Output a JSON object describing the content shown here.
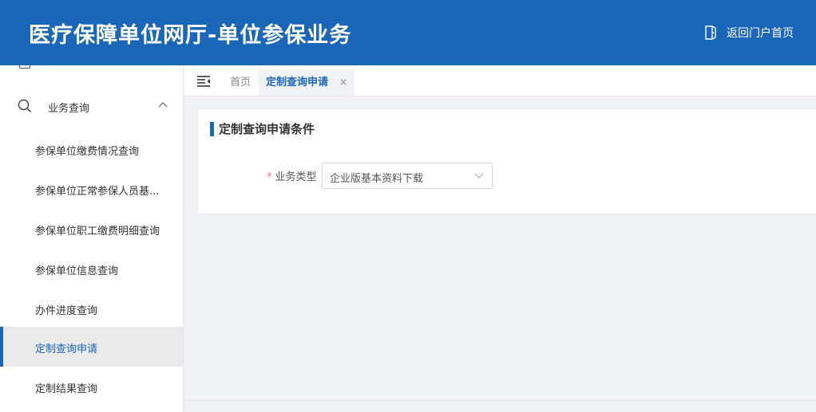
{
  "header": {
    "title": "医疗保障单位网厅-单位参保业务",
    "return_label": "返回门户首页"
  },
  "sidebar": {
    "group": {
      "label": "业务查询",
      "expanded": true
    },
    "items": [
      {
        "label": "参保单位缴费情况查询"
      },
      {
        "label": "参保单位正常参保人员基..."
      },
      {
        "label": "参保单位职工缴费明细查询"
      },
      {
        "label": "参保单位信息查询"
      },
      {
        "label": "办件进度查询"
      },
      {
        "label": "定制查询申请",
        "active": true
      },
      {
        "label": "定制结果查询"
      }
    ]
  },
  "tabs": {
    "home": "首页",
    "active": "定制查询申请",
    "close": "×"
  },
  "card": {
    "title": "定制查询申请条件",
    "field_required": "*",
    "field_label": "业务类型",
    "field_value": "企业版基本资料下载"
  },
  "colors": {
    "primary": "#1a66b9",
    "required": "#f56c6c",
    "background": "#f0f2f5"
  }
}
